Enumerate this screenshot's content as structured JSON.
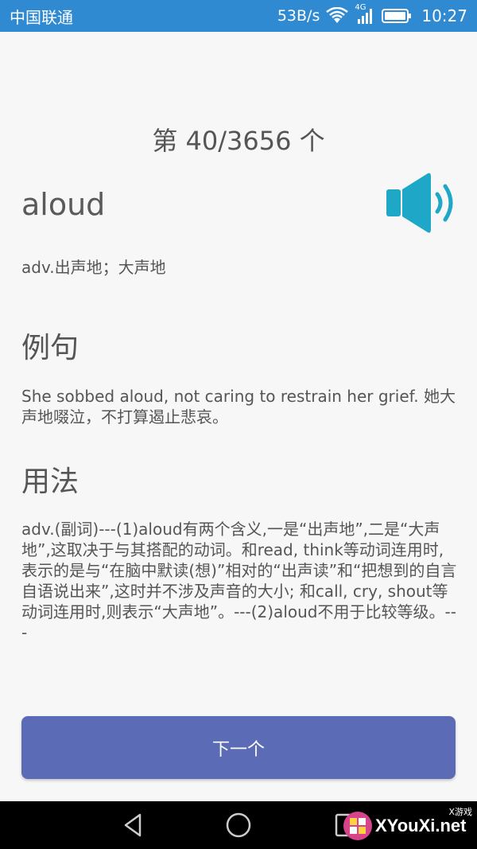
{
  "status_bar": {
    "carrier": "中国联通",
    "net_speed": "53B/s",
    "network_type": "4G",
    "time": "10:27"
  },
  "main": {
    "counter": "第 40/3656 个",
    "word": "aloud",
    "definition": "adv.出声地；大声地",
    "examples_title": "例句",
    "example_text": "She sobbed aloud, not caring to restrain her grief. 她大声地啜泣，不打算遏止悲哀。",
    "usage_title": "用法",
    "usage_text": "adv.(副词)---(1)aloud有两个含义,一是“出声地”,二是“大声地”,这取决于与其搭配的动词。和read, think等动词连用时,表示的是与“在脑中默读(想)”相对的“出声读”和“把想到的自言自语说出来”,这时并不涉及声音的大小; 和call, cry, shout等动词连用时,则表示“大声地”。---(2)aloud不用于比较等级。---"
  },
  "next_button": {
    "label": "下一个"
  },
  "watermark": {
    "text": "XYouXi.net",
    "small_text": "X游戏"
  },
  "colors": {
    "status_bar": "#2f8ad1",
    "accent_speaker": "#1fa7c7",
    "button": "#5c6bb5",
    "background": "#f7f7f7"
  },
  "icons": [
    "wifi-icon",
    "signal-icon",
    "battery-icon",
    "speaker-icon",
    "back-icon",
    "home-icon",
    "recent-apps-icon"
  ]
}
